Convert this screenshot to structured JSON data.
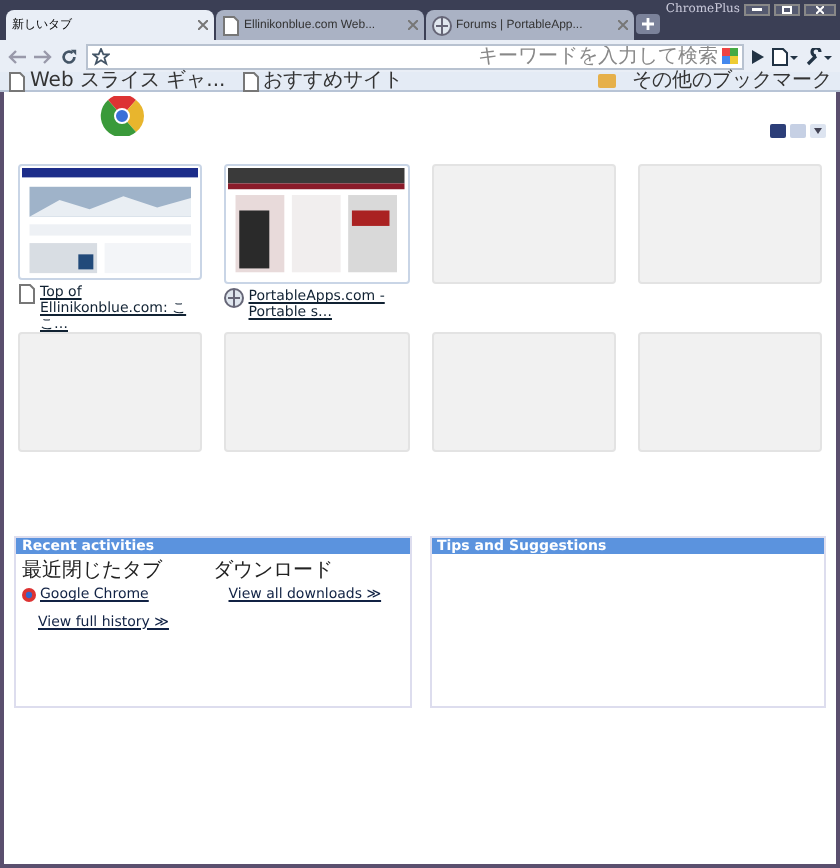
{
  "window": {
    "brand": "ChromePlus"
  },
  "tabs": [
    {
      "title": "新しいタブ",
      "selected": true
    },
    {
      "title": "Ellinikonblue.com Web...",
      "selected": false
    },
    {
      "title": "Forums | PortableApp...",
      "selected": false
    }
  ],
  "toolbar": {
    "search": {
      "placeholder": "キーワードを入力して検索"
    }
  },
  "bookmarks": {
    "items": [
      {
        "label": "Web スライス ギャ..."
      },
      {
        "label": "おすすめサイト"
      }
    ],
    "other": "その他のブックマーク"
  },
  "view_modes": [
    {
      "selected": true
    },
    {
      "selected": false
    }
  ],
  "thumbnails": [
    {
      "kind": "picture",
      "title": "Top of Ellinikonblue.com: ここ…"
    },
    {
      "kind": "picture",
      "title": "PortableApps.com - Portable s…"
    },
    {
      "kind": "empty"
    },
    {
      "kind": "empty"
    },
    {
      "kind": "empty"
    },
    {
      "kind": "empty"
    },
    {
      "kind": "empty"
    },
    {
      "kind": "empty"
    }
  ],
  "recent": {
    "title": "Recent activities",
    "closed_heading": "最近閉じたタブ",
    "closed_items": [
      "Google Chrome"
    ],
    "history_link": "View full history ≫",
    "downloads_heading": "ダウンロード",
    "downloads_link": "View all downloads ≫"
  },
  "tips": {
    "title": "Tips and Suggestions"
  }
}
